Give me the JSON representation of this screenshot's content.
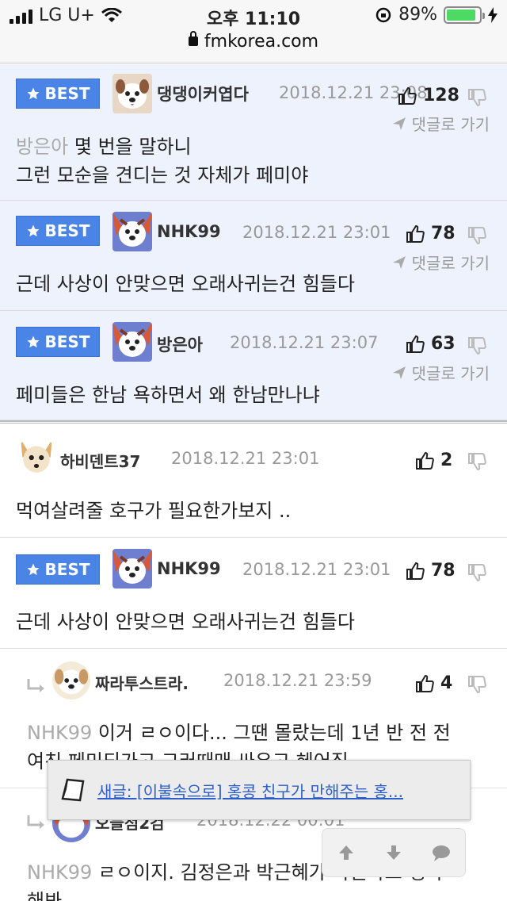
{
  "status_bar": {
    "carrier": "LG U+",
    "time": "오후 11:10",
    "battery": "89%",
    "battery_level": 0.89
  },
  "url_bar": {
    "domain": "fmkorea.com"
  },
  "best_label": "BEST",
  "goto_label": "댓글로 가기",
  "comments": [
    {
      "best": true,
      "author": "댕댕이커엽다",
      "date": "2018.12.21 23:08",
      "likes": "128",
      "mention": "방은아",
      "line1": " 몇 번을 말하니",
      "line2": "그런 모순을 견디는 것 자체가 페미야"
    },
    {
      "best": true,
      "author": "NHK99",
      "date": "2018.12.21 23:01",
      "likes": "78",
      "line1": "근데 사상이 안맞으면 오래사귀는건 힘들다"
    },
    {
      "best": true,
      "author": "방은아",
      "date": "2018.12.21 23:07",
      "likes": "63",
      "line1": "페미들은 한남 욕하면서 왜 한남만나냐"
    },
    {
      "best": false,
      "author": "하비덴트37",
      "date": "2018.12.21 23:01",
      "likes": "2",
      "line1": "먹여살려줄 호구가 필요한가보지 .."
    },
    {
      "best": true,
      "author": "NHK99",
      "date": "2018.12.21 23:01",
      "likes": "78",
      "line1": "근데 사상이 안맞으면 오래사귀는건 힘들다"
    },
    {
      "best": false,
      "reply": true,
      "author": "짜라투스트라.",
      "date": "2018.12.21 23:59",
      "likes": "4",
      "mention": "NHK99",
      "line1": " 이거 ㄹㅇ이다... 그땐 몰랐는데 1년 반 전 전",
      "line2": "여친 페미되가고 그러때매 싸우고 헤어짐"
    },
    {
      "best": false,
      "reply": true,
      "author": "오늘점2검",
      "date": "2018.12.22 00:01",
      "mention": "NHK99",
      "line1": " ㄹㅇ이지. 김정은과 박근혜가 사귄다고 생각",
      "line2": "해봐"
    }
  ],
  "toast": {
    "text": "새글: [이불속으로] 홍콩 친구가 만해주는 홍..."
  },
  "float_nav": {
    "icons": [
      "arrow-up-icon",
      "arrow-down-icon",
      "chat-bubble-icon"
    ]
  }
}
